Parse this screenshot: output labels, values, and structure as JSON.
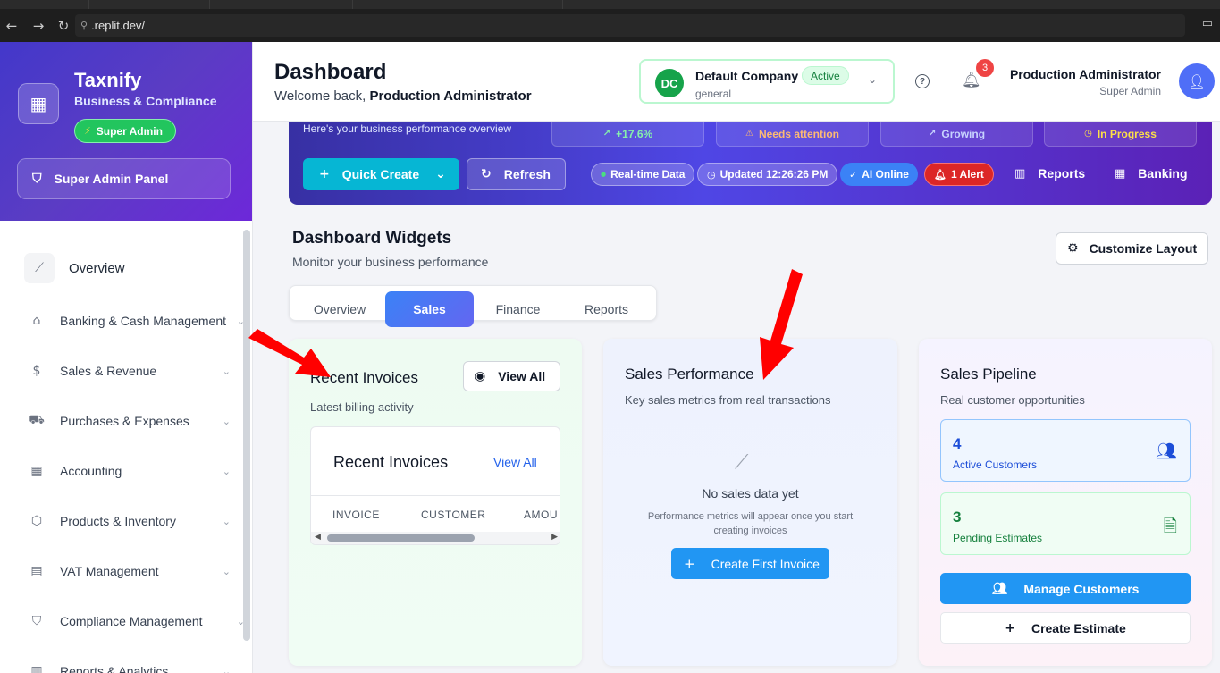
{
  "browser": {
    "url": ".replit.dev/"
  },
  "sidebar": {
    "brand_name": "Taxnify",
    "brand_sub": "Business & Compliance",
    "role_badge": "Super Admin",
    "panel_button": "Super Admin Panel",
    "items": [
      {
        "label": "Overview",
        "icon": "chart-line-icon"
      },
      {
        "label": "Banking & Cash Management",
        "icon": "bank-icon"
      },
      {
        "label": "Sales & Revenue",
        "icon": "dollar-icon"
      },
      {
        "label": "Purchases & Expenses",
        "icon": "truck-icon"
      },
      {
        "label": "Accounting",
        "icon": "calculator-icon"
      },
      {
        "label": "Products & Inventory",
        "icon": "box-icon"
      },
      {
        "label": "VAT Management",
        "icon": "receipt-icon"
      },
      {
        "label": "Compliance Management",
        "icon": "shield-icon"
      },
      {
        "label": "Reports & Analytics",
        "icon": "bar-chart-icon"
      }
    ]
  },
  "header": {
    "title": "Dashboard",
    "welcome": "Welcome back,",
    "user_bold": "Production Administrator",
    "company": {
      "initials": "DC",
      "name": "Default Company",
      "status": "Active",
      "type": "general"
    },
    "notification_count": "3",
    "user_name": "Production Administrator",
    "user_role": "Super Admin"
  },
  "hero": {
    "overview_text": "Here's your business performance overview",
    "stats": [
      "+17.6%",
      "Needs attention",
      "Growing",
      "In Progress"
    ],
    "quick_create": "Quick Create",
    "refresh": "Refresh",
    "realtime": "Real-time Data",
    "updated": "Updated 12:26:26 PM",
    "ai": "AI Online",
    "alert": "1 Alert",
    "reports": "Reports",
    "banking": "Banking"
  },
  "widgets": {
    "title": "Dashboard Widgets",
    "subtitle": "Monitor your business performance",
    "customize": "Customize Layout",
    "tabs": [
      "Overview",
      "Sales",
      "Finance",
      "Reports"
    ],
    "active_tab": "Sales"
  },
  "invoices_card": {
    "title": "Recent Invoices",
    "subtitle": "Latest billing activity",
    "view_all_button": "View All",
    "inner_title": "Recent Invoices",
    "inner_link": "View All",
    "columns": [
      "INVOICE",
      "CUSTOMER",
      "AMOU"
    ]
  },
  "performance_card": {
    "title": "Sales Performance",
    "subtitle": "Key sales metrics from real transactions",
    "empty_title": "No sales data yet",
    "empty_sub": "Performance metrics will appear once you start creating invoices",
    "cta": "Create First Invoice"
  },
  "pipeline_card": {
    "title": "Sales Pipeline",
    "subtitle": "Real customer opportunities",
    "active_customers_count": "4",
    "active_customers_label": "Active Customers",
    "pending_estimates_count": "3",
    "pending_estimates_label": "Pending Estimates",
    "manage_button": "Manage Customers",
    "estimate_button": "Create Estimate"
  },
  "colors": {
    "brand_gradient_start": "#4338ca",
    "brand_gradient_end": "#6d28d9",
    "primary_blue": "#2196f3",
    "active_green": "#16a34a",
    "alert_red": "#dc2626",
    "annotation_arrow": "#ff0000"
  }
}
